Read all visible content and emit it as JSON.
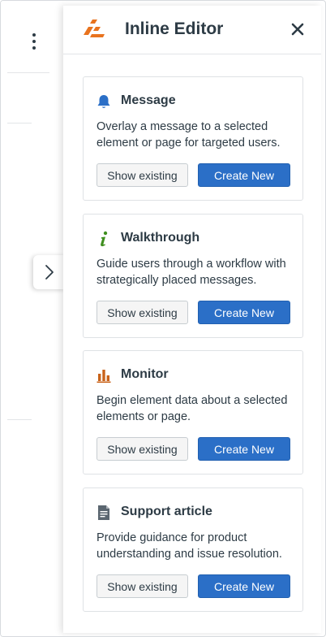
{
  "panel": {
    "title": "Inline Editor",
    "close_label": "close"
  },
  "cards": [
    {
      "icon": "bell-icon",
      "title": "Message",
      "description": "Overlay a message to a selected element or page for targeted users.",
      "show_label": "Show existing",
      "create_label": "Create New"
    },
    {
      "icon": "info-icon",
      "title": "Walkthrough",
      "description": "Guide users through a workflow with strategically placed messages.",
      "show_label": "Show existing",
      "create_label": "Create New"
    },
    {
      "icon": "bar-chart-icon",
      "title": "Monitor",
      "description": "Begin element data about a selected elements or page.",
      "show_label": "Show existing",
      "create_label": "Create New"
    },
    {
      "icon": "document-icon",
      "title": "Support article",
      "description": "Provide guidance for product understanding and issue resolution.",
      "show_label": "Show existing",
      "create_label": "Create New"
    }
  ],
  "colors": {
    "primary_button": "#2b6fc7",
    "logo_orange": "#e8731e",
    "message_icon": "#2b6fc7",
    "walkthrough_icon": "#3f8f1f",
    "monitor_icon": "#c9631a",
    "support_icon": "#5b6670"
  }
}
